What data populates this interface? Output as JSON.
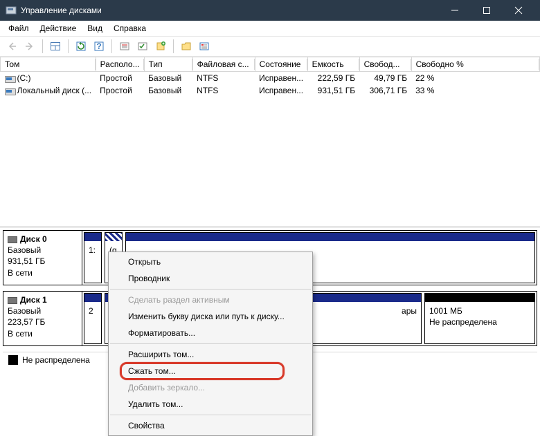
{
  "window": {
    "title": "Управление дисками"
  },
  "menubar": [
    "Файл",
    "Действие",
    "Вид",
    "Справка"
  ],
  "columns": [
    "Том",
    "Располо...",
    "Тип",
    "Файловая с...",
    "Состояние",
    "Емкость",
    "Свобод...",
    "Свободно %"
  ],
  "volumes": [
    {
      "name": "(C:)",
      "layout": "Простой",
      "type": "Базовый",
      "fs": "NTFS",
      "status": "Исправен...",
      "capacity": "222,59 ГБ",
      "free": "49,79 ГБ",
      "freepct": "22 %"
    },
    {
      "name": "Локальный диск (...",
      "layout": "Простой",
      "type": "Базовый",
      "fs": "NTFS",
      "status": "Исправен...",
      "capacity": "931,51 ГБ",
      "free": "306,71 ГБ",
      "freepct": "33 %"
    }
  ],
  "disks": [
    {
      "label": "Диск 0",
      "type": "Базовый",
      "size": "931,51 ГБ",
      "status": "В сети",
      "parts_stub": [
        "1:",
        "(g"
      ]
    },
    {
      "label": "Диск 1",
      "type": "Базовый",
      "size": "223,57 ГБ",
      "status": "В сети",
      "unalloc": {
        "size": "1001 МБ",
        "label": "Не распределена"
      },
      "parts_stub": [
        "2",
        "ары"
      ]
    }
  ],
  "legend": {
    "unalloc": "Не распределена"
  },
  "context_menu": {
    "open": "Открыть",
    "explorer": "Проводник",
    "make_active": "Сделать раздел активным",
    "change_letter": "Изменить букву диска или путь к диску...",
    "format": "Форматировать...",
    "extend": "Расширить том...",
    "shrink": "Сжать том...",
    "add_mirror": "Добавить зеркало...",
    "delete": "Удалить том...",
    "properties": "Свойства"
  }
}
